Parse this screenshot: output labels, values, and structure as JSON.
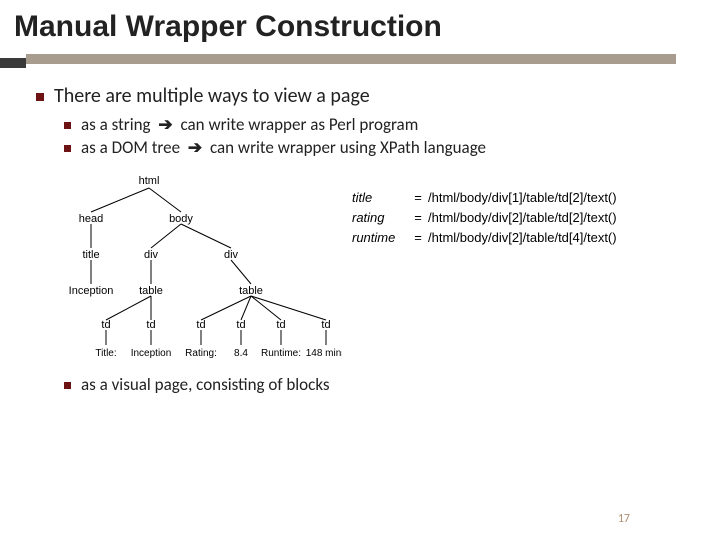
{
  "title": "Manual Wrapper Construction",
  "bullets": {
    "main": "There are multiple ways to view a page",
    "s1a": "as a string",
    "s1b": "can write wrapper as Perl program",
    "s2a": "as a DOM tree",
    "s2b": "can write wrapper using XPath language",
    "s3": "as a visual page, consisting of blocks"
  },
  "tree": {
    "n_html": "html",
    "n_head": "head",
    "n_body": "body",
    "n_title": "title",
    "n_div1": "div",
    "n_div2": "div",
    "n_inception": "Inception",
    "n_table1": "table",
    "n_table2": "table",
    "n_td": "td",
    "leaf_title": "Title:",
    "leaf_inception": "Inception",
    "leaf_rating": "Rating:",
    "leaf_84": "8.4",
    "leaf_runtime": "Runtime:",
    "leaf_148": "148 mins"
  },
  "xpath": {
    "r1k": "title",
    "r1v": "/html/body/div[1]/table/td[2]/text()",
    "r2k": "rating",
    "r2v": "/html/body/div[2]/table/td[2]/text()",
    "r3k": "runtime",
    "r3v": "/html/body/div[2]/table/td[4]/text()",
    "eq": "="
  },
  "page_number": "17"
}
